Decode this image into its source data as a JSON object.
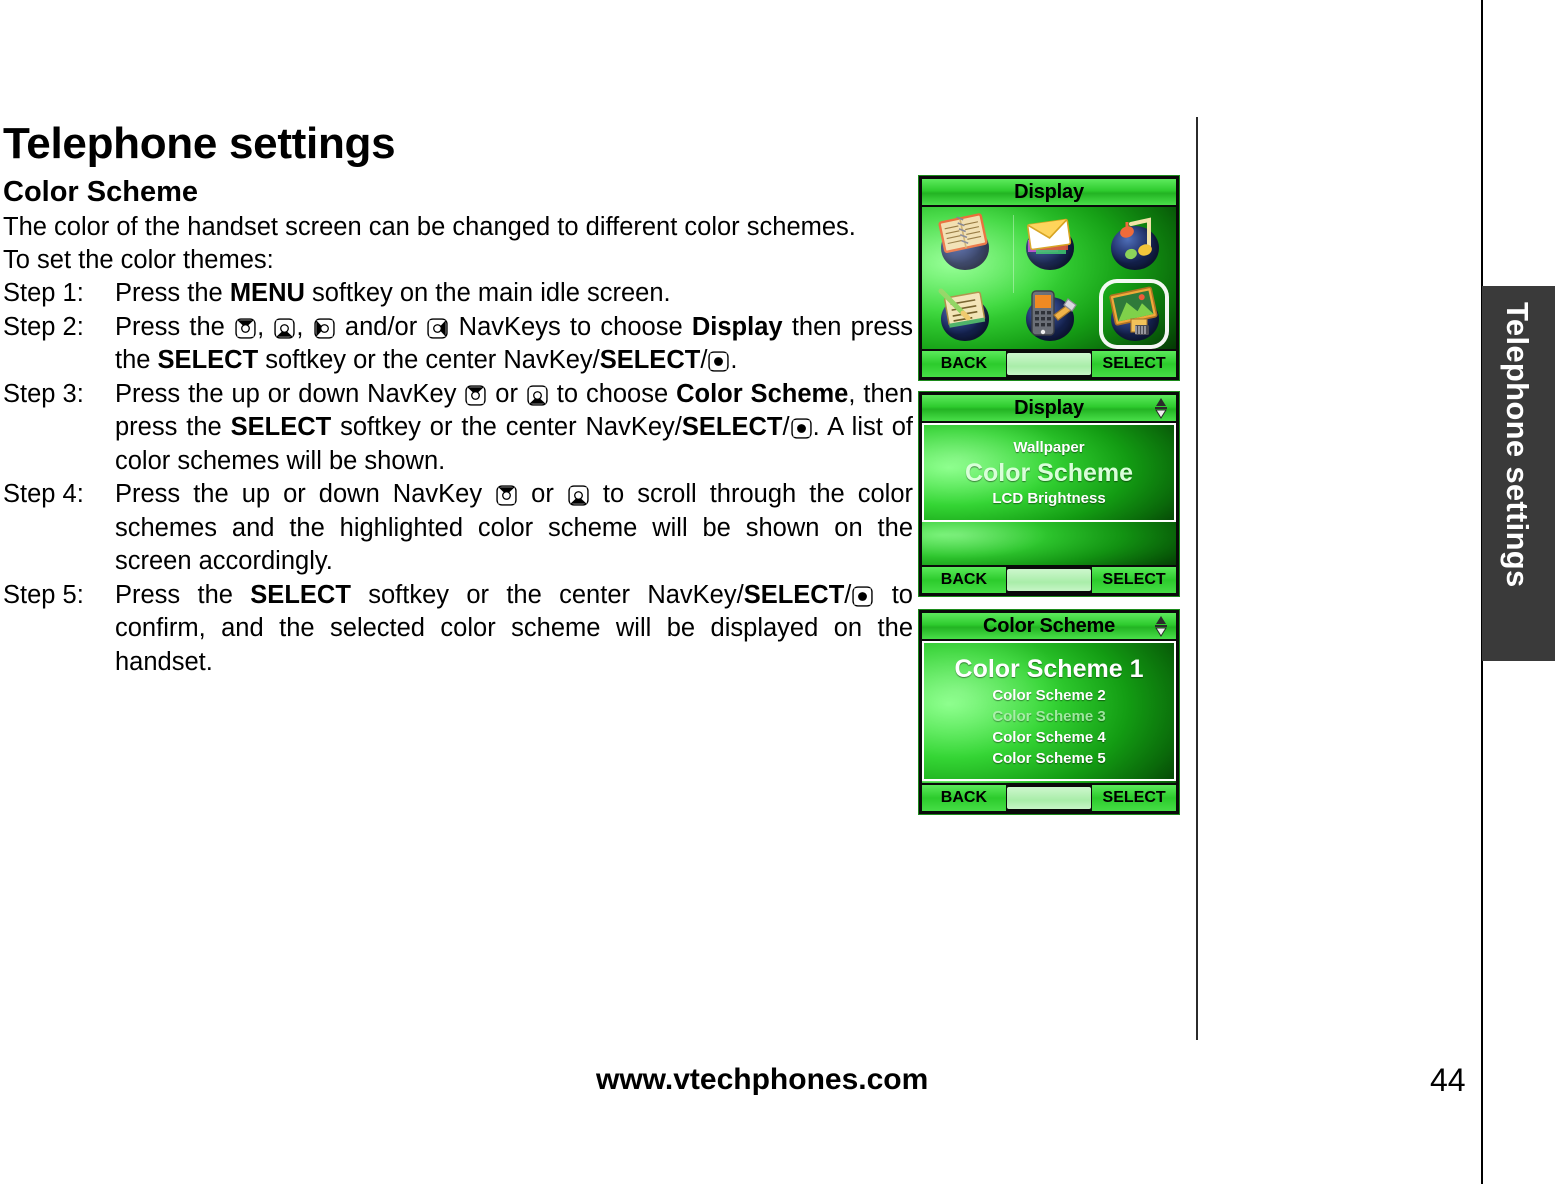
{
  "document": {
    "title": "Telephone settings",
    "section_heading": "Color Scheme",
    "intro_line1": "The color of the handset screen can be changed to different color schemes.",
    "intro_line2": "To set the color themes:",
    "footer_url": "www.vtechphones.com",
    "page_number": "44",
    "side_tab_label": "Telephone settings"
  },
  "steps": [
    {
      "label": "Step 1:",
      "parts": [
        {
          "t": "Press the ",
          "b": false
        },
        {
          "t": "MENU",
          "b": true
        },
        {
          "t": " softkey on the main idle screen.",
          "b": false
        }
      ]
    },
    {
      "label": "Step 2:",
      "parts": [
        {
          "t": "Press the ",
          "b": false
        },
        {
          "icon": "navkey-up"
        },
        {
          "t": ", ",
          "b": false
        },
        {
          "icon": "navkey-down"
        },
        {
          "t": ", ",
          "b": false
        },
        {
          "icon": "navkey-left"
        },
        {
          "t": " and/or ",
          "b": false
        },
        {
          "icon": "navkey-right"
        },
        {
          "t": " NavKeys to choose ",
          "b": false
        },
        {
          "t": "Display",
          "b": true
        },
        {
          "t": " then press the ",
          "b": false
        },
        {
          "t": "SELECT",
          "b": true
        },
        {
          "t": " softkey or the center NavKey/",
          "b": false
        },
        {
          "t": "SELECT",
          "b": true
        },
        {
          "t": "/",
          "b": false
        },
        {
          "icon": "navkey-center"
        },
        {
          "t": ".",
          "b": false
        }
      ]
    },
    {
      "label": "Step 3:",
      "parts": [
        {
          "t": "Press the up or down NavKey ",
          "b": false
        },
        {
          "icon": "navkey-up"
        },
        {
          "t": " or ",
          "b": false
        },
        {
          "icon": "navkey-down"
        },
        {
          "t": " to choose ",
          "b": false
        },
        {
          "t": "Color Scheme",
          "b": true
        },
        {
          "t": ", then press the ",
          "b": false
        },
        {
          "t": "SELECT",
          "b": true
        },
        {
          "t": " softkey or the center NavKey/",
          "b": false
        },
        {
          "t": "SELECT",
          "b": true
        },
        {
          "t": "/",
          "b": false
        },
        {
          "icon": "navkey-center"
        },
        {
          "t": ". A list of color schemes will be shown.",
          "b": false
        }
      ]
    },
    {
      "label": "Step 4:",
      "parts": [
        {
          "t": "Press the up or down NavKey ",
          "b": false
        },
        {
          "icon": "navkey-up"
        },
        {
          "t": " or ",
          "b": false
        },
        {
          "icon": "navkey-down"
        },
        {
          "t": " to scroll through the color schemes and the highlighted color scheme will be shown on the screen accordingly.",
          "b": false
        }
      ]
    },
    {
      "label": "Step 5:",
      "parts": [
        {
          "t": "Press the ",
          "b": false
        },
        {
          "t": "SELECT",
          "b": true
        },
        {
          "t": " softkey or the center NavKey/",
          "b": false
        },
        {
          "t": "SELECT",
          "b": true
        },
        {
          "t": "/",
          "b": false
        },
        {
          "icon": "navkey-center"
        },
        {
          "t": " to confirm, and the selected color scheme will be displayed on the handset.",
          "b": false
        }
      ]
    }
  ],
  "figures": {
    "screen1": {
      "title": "Display",
      "has_scroll_indicator": false,
      "type": "icon-grid",
      "icons": [
        {
          "name": "phonebook-icon",
          "selected": false
        },
        {
          "name": "messages-icon",
          "selected": false
        },
        {
          "name": "music-icon",
          "selected": false
        },
        {
          "name": "memo-icon",
          "selected": false
        },
        {
          "name": "handset-settings-icon",
          "selected": false
        },
        {
          "name": "display-icon",
          "selected": true
        }
      ],
      "softkeys": {
        "left": "BACK",
        "right": "SELECT"
      }
    },
    "screen2": {
      "title": "Display",
      "has_scroll_indicator": true,
      "type": "list",
      "items": [
        {
          "label": "Wallpaper",
          "state": "normal"
        },
        {
          "label": "Color Scheme",
          "state": "highlighted"
        },
        {
          "label": "LCD Brightness",
          "state": "normal"
        }
      ],
      "softkeys": {
        "left": "BACK",
        "right": "SELECT"
      }
    },
    "screen3": {
      "title": "Color Scheme",
      "has_scroll_indicator": true,
      "type": "list",
      "items": [
        {
          "label": "Color Scheme 1",
          "state": "highlighted"
        },
        {
          "label": "Color Scheme 2",
          "state": "normal"
        },
        {
          "label": "Color Scheme 3",
          "state": "dim"
        },
        {
          "label": "Color Scheme 4",
          "state": "normal"
        },
        {
          "label": "Color Scheme 5",
          "state": "normal"
        }
      ],
      "softkeys": {
        "left": "BACK",
        "right": "SELECT"
      }
    }
  },
  "colors": {
    "screen_green_light": "#5dea5d",
    "screen_green_dark": "#0a6b0a",
    "side_tab_bg": "#3a3a3a",
    "rule": "#2b2b2b"
  }
}
